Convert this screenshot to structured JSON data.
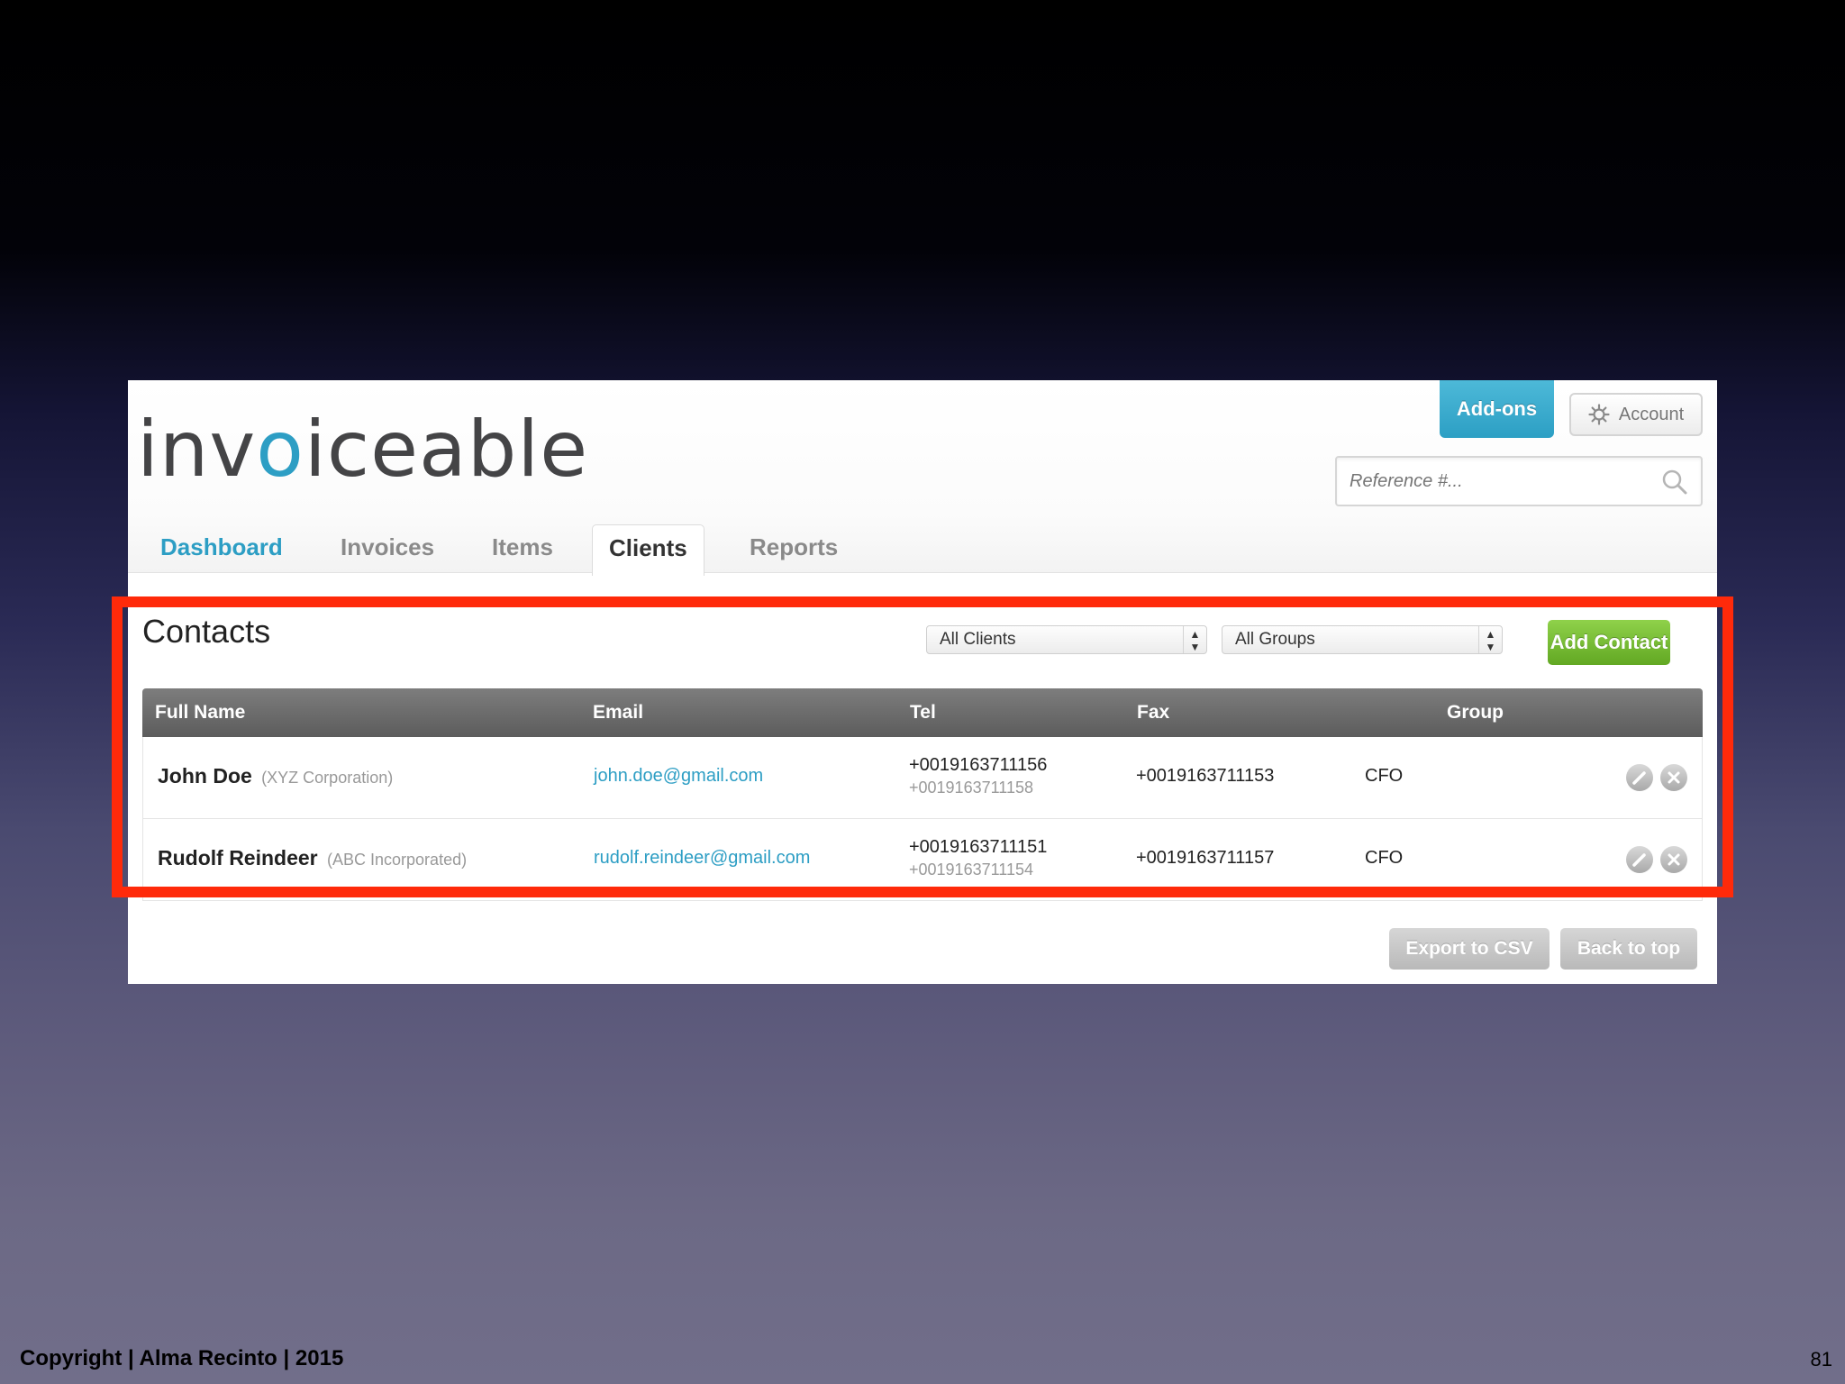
{
  "app": {
    "logo_prefix": "inv",
    "logo_o": "o",
    "logo_suffix": "iceable"
  },
  "header": {
    "addons_label": "Add-ons",
    "account_label": "Account",
    "account_icon": "gear-icon",
    "search_placeholder": "Reference #...",
    "search_icon": "search-icon"
  },
  "nav": {
    "tabs": [
      {
        "label": "Dashboard"
      },
      {
        "label": "Invoices"
      },
      {
        "label": "Items"
      },
      {
        "label": "Clients"
      },
      {
        "label": "Reports"
      }
    ]
  },
  "contacts": {
    "title": "Contacts",
    "client_filter": "All Clients",
    "group_filter": "All Groups",
    "add_label": "Add Contact",
    "columns": [
      "Full Name",
      "Email",
      "Tel",
      "Fax",
      "Group"
    ],
    "rows": [
      {
        "name": "John Doe",
        "company": "(XYZ Corporation)",
        "email": "john.doe@gmail.com",
        "tel": "+0019163711156",
        "tel_secondary": "+0019163711158",
        "fax": "+0019163711153",
        "group": "CFO"
      },
      {
        "name": "Rudolf Reindeer",
        "company": "(ABC Incorporated)",
        "email": "rudolf.reindeer@gmail.com",
        "tel": "+0019163711151",
        "tel_secondary": "+0019163711154",
        "fax": "+0019163711157",
        "group": "CFO"
      }
    ],
    "export_label": "Export to CSV",
    "back_label": "Back to top"
  },
  "slide": {
    "copyright": "Copyright | Alma Recinto | 2015",
    "page_number": "81",
    "highlight_color": "#ff2a0a"
  },
  "colors": {
    "brand_blue": "#2d9ec4",
    "add_green": "#62a823"
  }
}
